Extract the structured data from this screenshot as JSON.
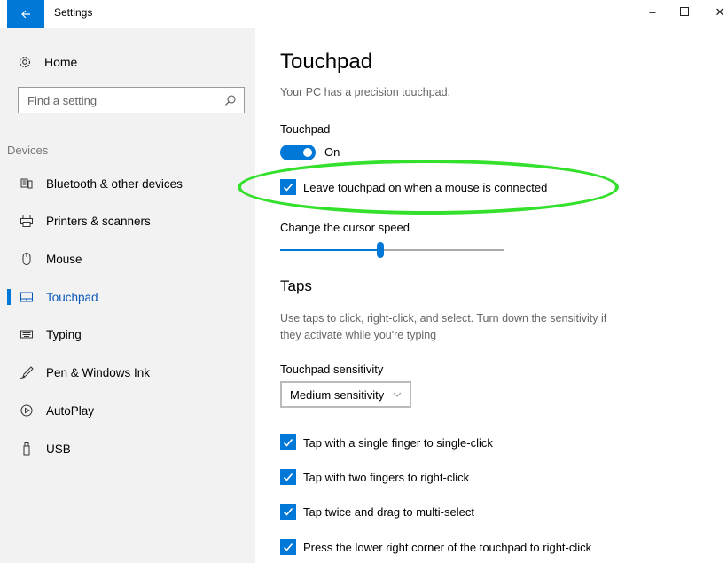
{
  "window": {
    "title": "Settings"
  },
  "sidebar": {
    "home_label": "Home",
    "search": {
      "placeholder": "Find a setting"
    },
    "group_label": "Devices",
    "items": [
      {
        "label": "Bluetooth & other devices",
        "icon": "bluetooth-devices-icon"
      },
      {
        "label": "Printers & scanners",
        "icon": "printer-icon"
      },
      {
        "label": "Mouse",
        "icon": "mouse-icon"
      },
      {
        "label": "Touchpad",
        "icon": "touchpad-icon",
        "active": true
      },
      {
        "label": "Typing",
        "icon": "keyboard-icon"
      },
      {
        "label": "Pen & Windows Ink",
        "icon": "pen-icon"
      },
      {
        "label": "AutoPlay",
        "icon": "autoplay-icon"
      },
      {
        "label": "USB",
        "icon": "usb-icon"
      }
    ]
  },
  "main": {
    "title": "Touchpad",
    "precision_note": "Your PC has a precision touchpad.",
    "touchpad_label": "Touchpad",
    "toggle_state": "On",
    "leave_on_label": "Leave touchpad on when a mouse is connected",
    "cursor_speed_label": "Change the cursor speed",
    "cursor_speed_fraction": 0.45,
    "taps_title": "Taps",
    "taps_desc_line1": "Use taps to click, right-click, and select. Turn down the sensitivity if",
    "taps_desc_line2": "they activate while you're typing",
    "sensitivity_label": "Touchpad sensitivity",
    "sensitivity_value": "Medium sensitivity",
    "tap_options": [
      "Tap with a single finger to single-click",
      "Tap with two fingers to right-click",
      "Tap twice and drag to multi-select",
      "Press the lower right corner of the touchpad to right-click"
    ]
  },
  "colors": {
    "accent": "#0078d7",
    "highlight": "#33e02b",
    "sidebar_bg": "#f2f2f2"
  }
}
